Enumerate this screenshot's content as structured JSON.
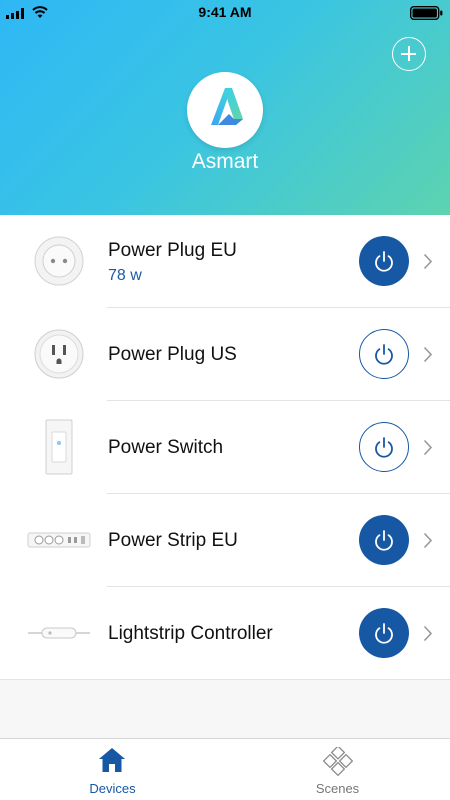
{
  "status_bar": {
    "time": "9:41 AM"
  },
  "app": {
    "name": "Asmart"
  },
  "devices": [
    {
      "name": "Power Plug EU",
      "power": "78 w",
      "state": "on",
      "thumb": "eu-plug-icon"
    },
    {
      "name": "Power Plug US",
      "state": "off",
      "thumb": "us-plug-icon"
    },
    {
      "name": "Power Switch",
      "state": "off",
      "thumb": "wall-switch-icon"
    },
    {
      "name": "Power Strip EU",
      "state": "on",
      "thumb": "power-strip-icon"
    },
    {
      "name": "Lightstrip Controller",
      "state": "on",
      "thumb": "lightstrip-controller-icon"
    }
  ],
  "tabs": [
    {
      "label": "Devices",
      "active": true,
      "icon": "home-icon"
    },
    {
      "label": "Scenes",
      "active": false,
      "icon": "scenes-icon"
    }
  ],
  "colors": {
    "accent": "#1758a5",
    "gradient_start": "#2fb7f5",
    "gradient_end": "#5dd3b0"
  }
}
